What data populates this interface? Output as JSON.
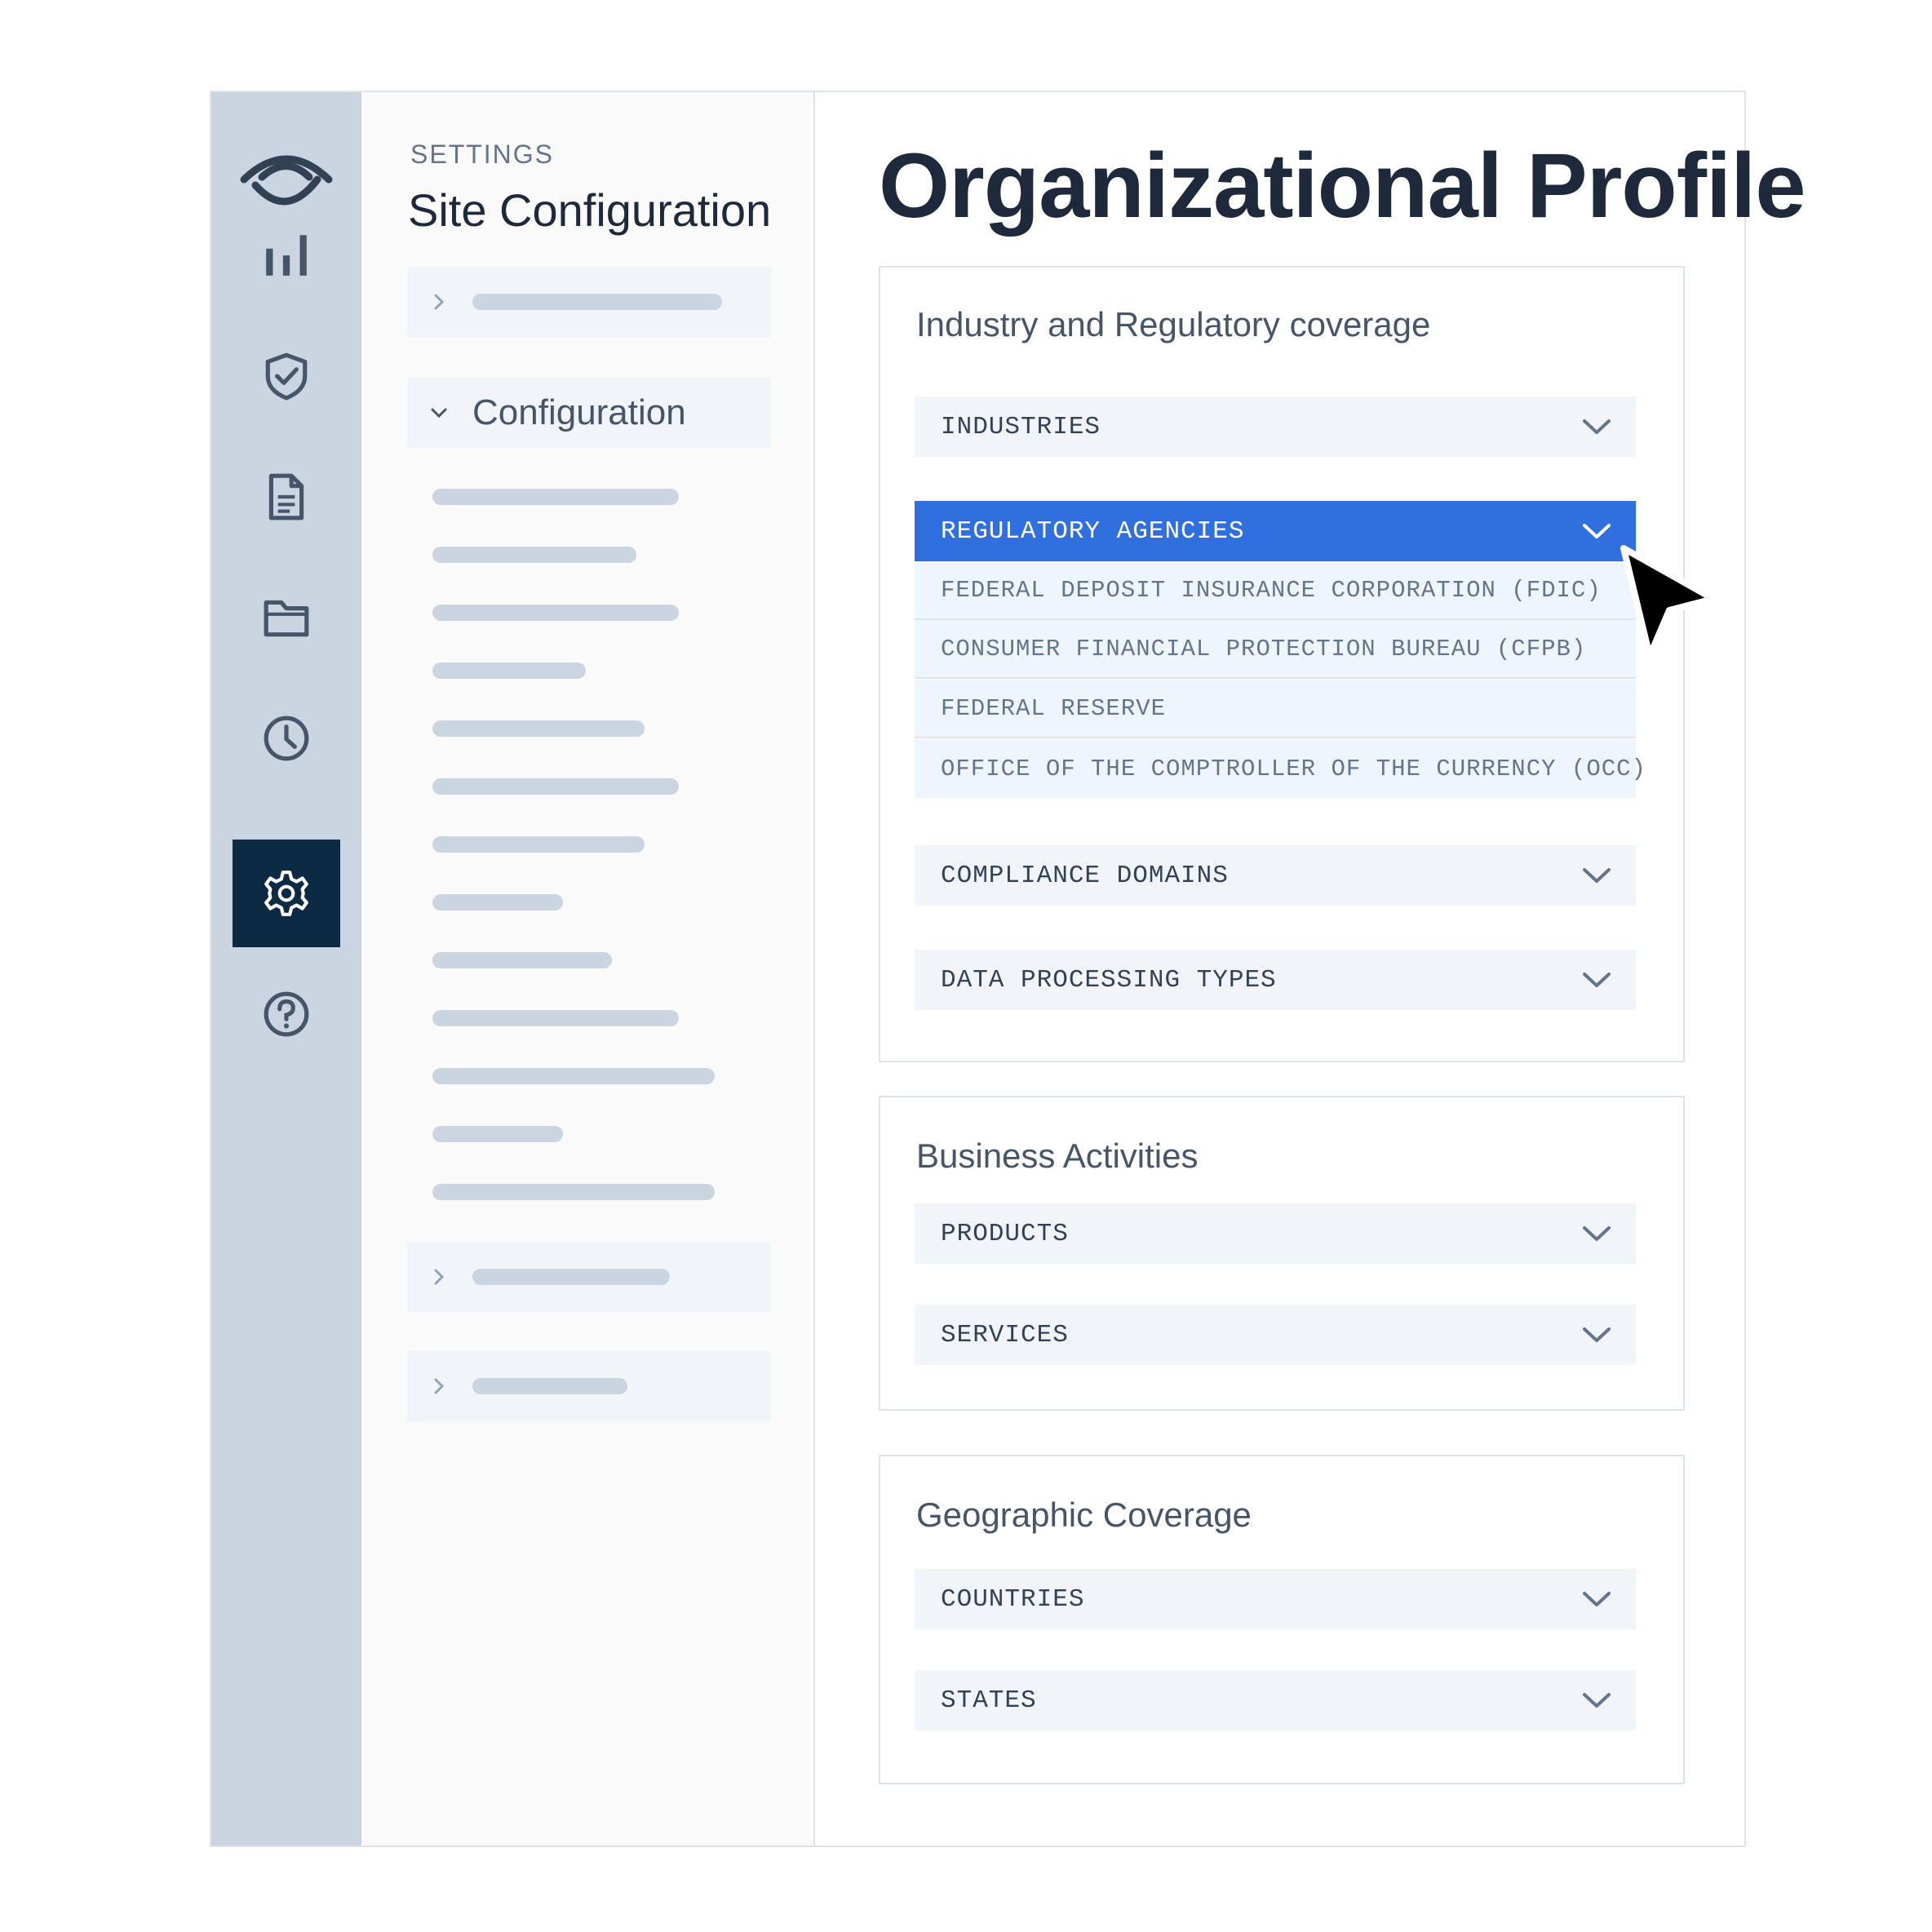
{
  "rail": {
    "items": [
      {
        "icon": "bar-chart-icon",
        "active": false
      },
      {
        "icon": "shield-check-icon",
        "active": false
      },
      {
        "icon": "document-icon",
        "active": false
      },
      {
        "icon": "folder-icon",
        "active": false
      },
      {
        "icon": "clock-icon",
        "active": false
      },
      {
        "icon": "gear-icon",
        "active": true
      },
      {
        "icon": "help-icon",
        "active": false
      }
    ]
  },
  "settings": {
    "eyebrow": "SETTINGS",
    "title": "Site Configuration",
    "expanded_group": "Configuration"
  },
  "main": {
    "title": "Organizational Profile",
    "sections": [
      {
        "title": "Industry and Regulatory coverage",
        "dropdowns": [
          {
            "label": "INDUSTRIES",
            "open": false
          },
          {
            "label": "REGULATORY AGENCIES",
            "open": true,
            "options": [
              "FEDERAL DEPOSIT INSURANCE CORPORATION (FDIC)",
              "CONSUMER FINANCIAL PROTECTION BUREAU (CFPB)",
              "FEDERAL RESERVE",
              "OFFICE OF THE COMPTROLLER OF THE CURRENCY (OCC)"
            ]
          },
          {
            "label": "COMPLIANCE DOMAINS",
            "open": false
          },
          {
            "label": "DATA PROCESSING TYPES",
            "open": false
          }
        ]
      },
      {
        "title": "Business Activities",
        "dropdowns": [
          {
            "label": "PRODUCTS",
            "open": false
          },
          {
            "label": "SERVICES",
            "open": false
          }
        ]
      },
      {
        "title": "Geographic Coverage",
        "dropdowns": [
          {
            "label": "COUNTRIES",
            "open": false
          },
          {
            "label": "STATES",
            "open": false
          }
        ]
      }
    ]
  },
  "colors": {
    "rail_bg": "#cbd5e1",
    "active_rail": "#0c2a44",
    "accent": "#2f6fde",
    "text_dark": "#1e293b"
  }
}
